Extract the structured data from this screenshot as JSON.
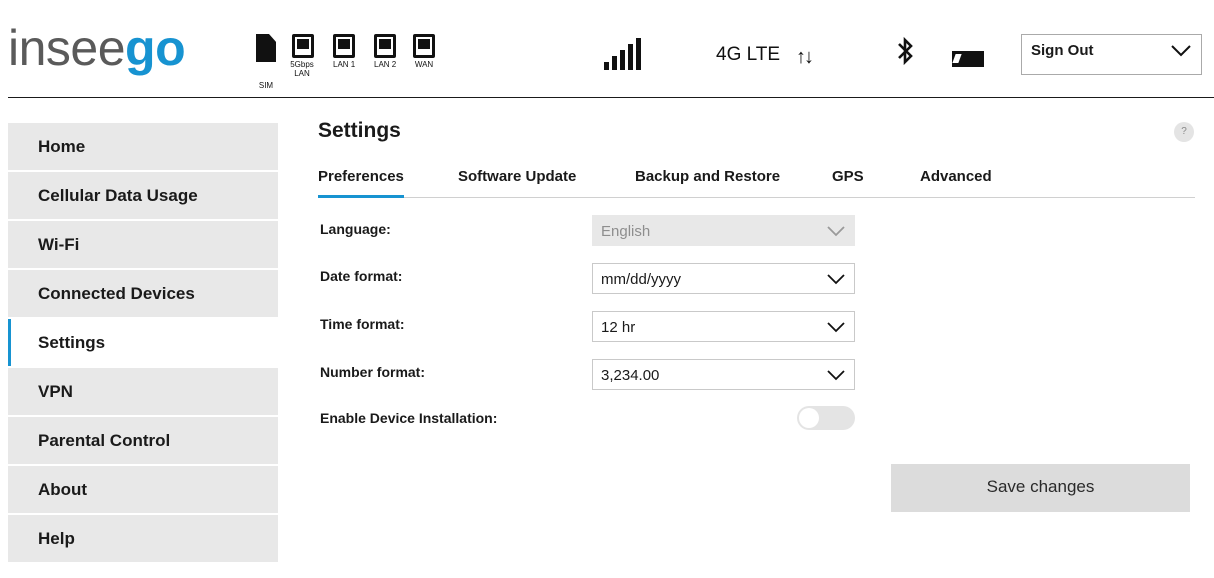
{
  "header": {
    "logo_light": "insee",
    "logo_bold": "go",
    "ports": [
      {
        "label": "SIM",
        "icon": "sim-card-icon"
      },
      {
        "label": "5Gbps LAN",
        "icon": "ethernet-port-icon"
      },
      {
        "label": "LAN 1",
        "icon": "ethernet-port-icon"
      },
      {
        "label": "LAN 2",
        "icon": "ethernet-port-icon"
      },
      {
        "label": "WAN",
        "icon": "ethernet-port-icon"
      }
    ],
    "network_type": "4G LTE",
    "icons": [
      "signal-strength-icon",
      "data-transfer-icon",
      "bluetooth-icon",
      "battery-icon"
    ],
    "signout_label": "Sign Out"
  },
  "sidebar": {
    "items": [
      {
        "label": "Home",
        "active": false
      },
      {
        "label": "Cellular Data Usage",
        "active": false
      },
      {
        "label": "Wi-Fi",
        "active": false
      },
      {
        "label": "Connected Devices",
        "active": false
      },
      {
        "label": "Settings",
        "active": true
      },
      {
        "label": "VPN",
        "active": false
      },
      {
        "label": "Parental Control",
        "active": false
      },
      {
        "label": "About",
        "active": false
      },
      {
        "label": "Help",
        "active": false
      }
    ]
  },
  "main": {
    "title": "Settings",
    "help_label": "?",
    "tabs": [
      {
        "label": "Preferences",
        "active": true
      },
      {
        "label": "Software Update",
        "active": false
      },
      {
        "label": "Backup and Restore",
        "active": false
      },
      {
        "label": "GPS",
        "active": false
      },
      {
        "label": "Advanced",
        "active": false
      }
    ],
    "fields": {
      "language": {
        "label": "Language:",
        "value": "English",
        "disabled": true
      },
      "date_format": {
        "label": "Date format:",
        "value": "mm/dd/yyyy"
      },
      "time_format": {
        "label": "Time format:",
        "value": "12 hr"
      },
      "number_format": {
        "label": "Number format:",
        "value": "3,234.00"
      },
      "device_installation": {
        "label": "Enable Device Installation:",
        "enabled": false
      }
    },
    "save_label": "Save changes"
  },
  "colors": {
    "accent": "#1793d1",
    "nav_bg": "#e8e8e8",
    "button_bg": "#dcdcdc"
  }
}
